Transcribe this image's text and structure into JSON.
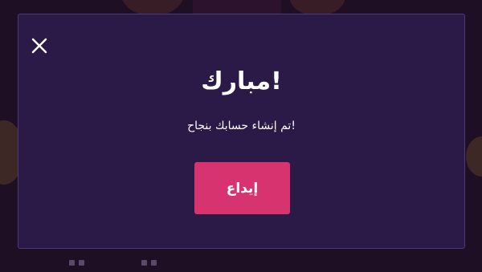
{
  "modal": {
    "title": "!مبارك",
    "message": "!تم إنشاء حسابك بنجاح",
    "deposit_label": "إيداع",
    "close_icon": "close-icon"
  },
  "colors": {
    "overlay_background": "#1e0f24",
    "modal_background": "#2b1a47",
    "modal_border": "#4d3a78",
    "accent_button": "#d6336f",
    "text": "#ffffff"
  }
}
